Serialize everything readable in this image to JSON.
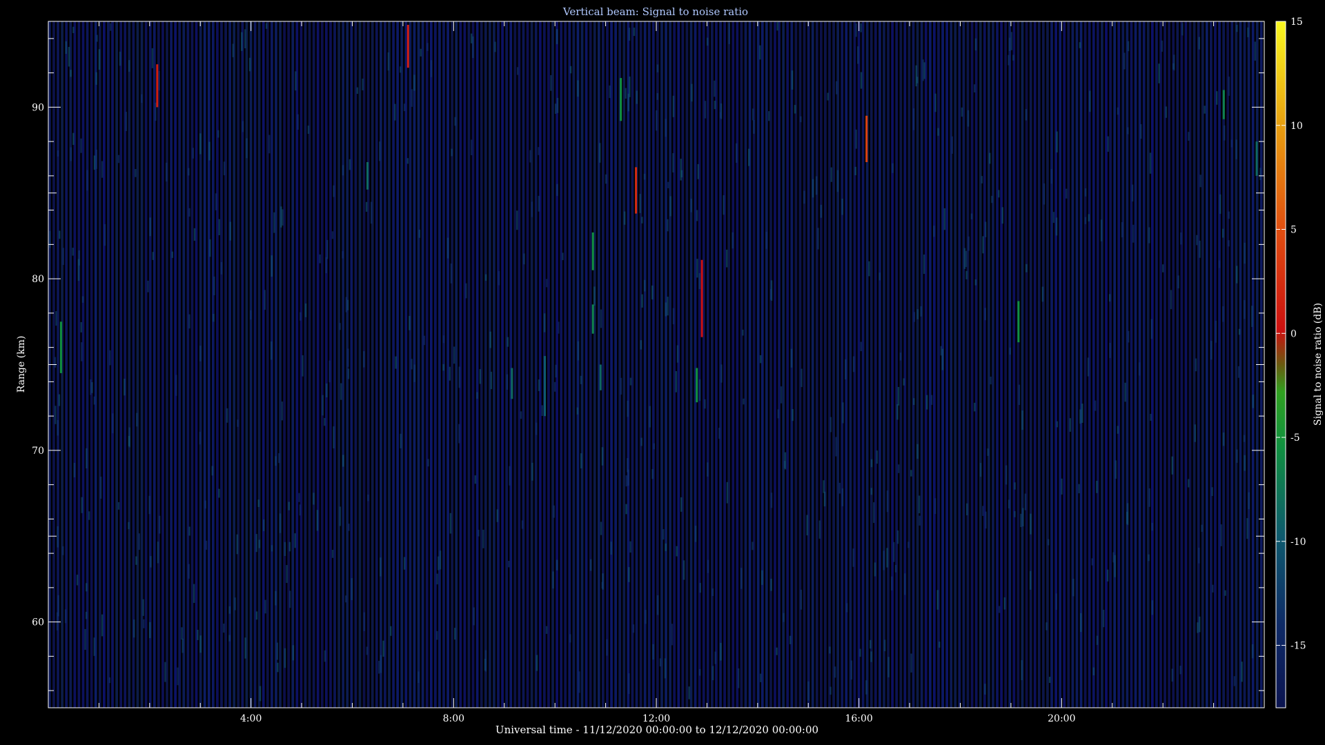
{
  "chart_data": {
    "type": "heatmap",
    "title": "Vertical beam: Signal to noise ratio",
    "xlabel": "Universal time - 11/12/2020 00:00:00 to 12/12/2020 00:00:00",
    "ylabel": "Range (km)",
    "x_unit": "hours UT",
    "xlim": [
      0,
      24
    ],
    "ylim": [
      55,
      95
    ],
    "x_ticks": [
      4,
      8,
      12,
      16,
      20
    ],
    "x_tick_labels": [
      "4:00",
      "8:00",
      "12:00",
      "16:00",
      "20:00"
    ],
    "y_ticks": [
      60,
      70,
      80,
      90
    ],
    "y_tick_labels": [
      "60",
      "70",
      "80",
      "90"
    ],
    "colorbar": {
      "label": "Signal to noise ratio (dB)",
      "range": [
        -18,
        15
      ],
      "ticks": [
        -15,
        -10,
        -5,
        0,
        5,
        10,
        15
      ],
      "tick_labels": [
        "-15",
        "-10",
        "-5",
        "0",
        "5",
        "10",
        "15"
      ],
      "colors": [
        "#0b1450",
        "#0e3a6e",
        "#107a5a",
        "#10a030",
        "#3a8a10",
        "#cc1010",
        "#e05010",
        "#e8a010",
        "#f0f020"
      ]
    },
    "background_snr_db": -17,
    "echoes": [
      {
        "time": 0.25,
        "range_bottom": 74.5,
        "range_top": 77.5,
        "snr_db": -6
      },
      {
        "time": 2.15,
        "range_bottom": 90.0,
        "range_top": 92.5,
        "snr_db": 1
      },
      {
        "time": 6.3,
        "range_bottom": 85.2,
        "range_top": 86.8,
        "snr_db": -9
      },
      {
        "time": 7.1,
        "range_bottom": 92.3,
        "range_top": 94.8,
        "snr_db": 1
      },
      {
        "time": 9.15,
        "range_bottom": 73.0,
        "range_top": 74.8,
        "snr_db": -9
      },
      {
        "time": 9.8,
        "range_bottom": 72.0,
        "range_top": 75.5,
        "snr_db": -10
      },
      {
        "time": 10.75,
        "range_bottom": 80.5,
        "range_top": 82.7,
        "snr_db": -6
      },
      {
        "time": 10.75,
        "range_bottom": 76.8,
        "range_top": 78.5,
        "snr_db": -7
      },
      {
        "time": 10.9,
        "range_bottom": 73.5,
        "range_top": 75.0,
        "snr_db": -9
      },
      {
        "time": 11.3,
        "range_bottom": 89.2,
        "range_top": 91.7,
        "snr_db": -6
      },
      {
        "time": 11.6,
        "range_bottom": 83.8,
        "range_top": 86.5,
        "snr_db": 2
      },
      {
        "time": 12.8,
        "range_bottom": 72.8,
        "range_top": 74.8,
        "snr_db": -6
      },
      {
        "time": 12.9,
        "range_bottom": 76.6,
        "range_top": 81.1,
        "snr_db": 0
      },
      {
        "time": 16.15,
        "range_bottom": 86.8,
        "range_top": 89.5,
        "snr_db": 4
      },
      {
        "time": 19.15,
        "range_bottom": 76.3,
        "range_top": 78.7,
        "snr_db": -6
      },
      {
        "time": 23.2,
        "range_bottom": 89.3,
        "range_top": 91.0,
        "snr_db": -7
      },
      {
        "time": 23.85,
        "range_bottom": 86.0,
        "range_top": 88.0,
        "snr_db": -9
      }
    ]
  }
}
